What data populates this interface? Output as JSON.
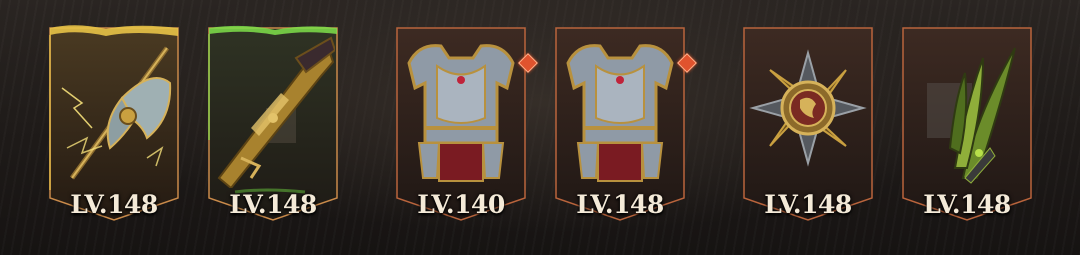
{
  "equipment": [
    {
      "level": "LV.148",
      "item_icon": "golden-axe-icon",
      "rarity_color": "#e8c347",
      "new_badge": false
    },
    {
      "level": "LV.148",
      "item_icon": "golden-gun-icon",
      "rarity_color": "#7ee04a",
      "new_badge": false
    },
    {
      "level": "LV.140",
      "item_icon": "chest-armor-icon",
      "rarity_color": "#b9643c",
      "new_badge": true
    },
    {
      "level": "LV.148",
      "item_icon": "chest-armor-icon",
      "rarity_color": "#b9643c",
      "new_badge": true
    },
    {
      "level": "LV.148",
      "item_icon": "medal-emblem-icon",
      "rarity_color": "#b9643c",
      "new_badge": false
    },
    {
      "level": "LV.148",
      "item_icon": "feathered-plume-icon",
      "rarity_color": "#b9643c",
      "new_badge": false
    }
  ]
}
